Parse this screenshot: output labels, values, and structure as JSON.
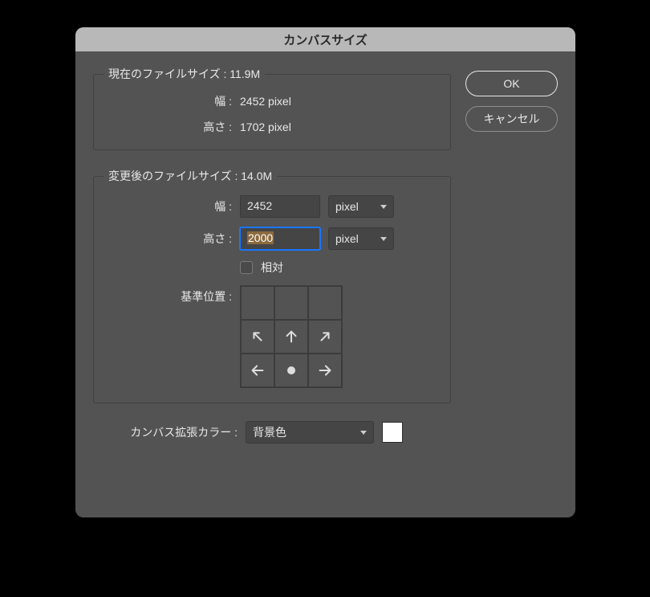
{
  "title": "カンバスサイズ",
  "current": {
    "legend_prefix": "現在のファイルサイズ : ",
    "filesize": "11.9M",
    "width_label": "幅 :",
    "width_value": "2452 pixel",
    "height_label": "高さ :",
    "height_value": "1702 pixel"
  },
  "new": {
    "legend_prefix": "変更後のファイルサイズ : ",
    "filesize": "14.0M",
    "width_label": "幅 :",
    "width_value": "2452",
    "width_unit": "pixel",
    "height_label": "高さ :",
    "height_value": "2000",
    "height_unit": "pixel",
    "relative_label": "相対",
    "anchor_label": "基準位置 :"
  },
  "extension": {
    "label": "カンバス拡張カラー :",
    "value": "背景色",
    "swatch_color": "#ffffff"
  },
  "buttons": {
    "ok": "OK",
    "cancel": "キャンセル"
  }
}
